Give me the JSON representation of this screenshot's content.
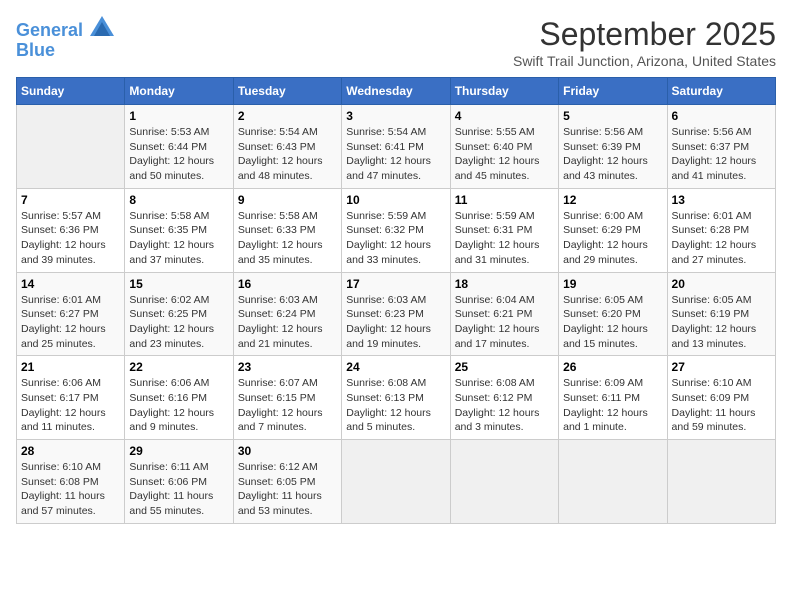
{
  "logo": {
    "line1": "General",
    "line2": "Blue"
  },
  "title": "September 2025",
  "location": "Swift Trail Junction, Arizona, United States",
  "days_of_week": [
    "Sunday",
    "Monday",
    "Tuesday",
    "Wednesday",
    "Thursday",
    "Friday",
    "Saturday"
  ],
  "weeks": [
    [
      {
        "day": "",
        "info": ""
      },
      {
        "day": "1",
        "info": "Sunrise: 5:53 AM\nSunset: 6:44 PM\nDaylight: 12 hours\nand 50 minutes."
      },
      {
        "day": "2",
        "info": "Sunrise: 5:54 AM\nSunset: 6:43 PM\nDaylight: 12 hours\nand 48 minutes."
      },
      {
        "day": "3",
        "info": "Sunrise: 5:54 AM\nSunset: 6:41 PM\nDaylight: 12 hours\nand 47 minutes."
      },
      {
        "day": "4",
        "info": "Sunrise: 5:55 AM\nSunset: 6:40 PM\nDaylight: 12 hours\nand 45 minutes."
      },
      {
        "day": "5",
        "info": "Sunrise: 5:56 AM\nSunset: 6:39 PM\nDaylight: 12 hours\nand 43 minutes."
      },
      {
        "day": "6",
        "info": "Sunrise: 5:56 AM\nSunset: 6:37 PM\nDaylight: 12 hours\nand 41 minutes."
      }
    ],
    [
      {
        "day": "7",
        "info": "Sunrise: 5:57 AM\nSunset: 6:36 PM\nDaylight: 12 hours\nand 39 minutes."
      },
      {
        "day": "8",
        "info": "Sunrise: 5:58 AM\nSunset: 6:35 PM\nDaylight: 12 hours\nand 37 minutes."
      },
      {
        "day": "9",
        "info": "Sunrise: 5:58 AM\nSunset: 6:33 PM\nDaylight: 12 hours\nand 35 minutes."
      },
      {
        "day": "10",
        "info": "Sunrise: 5:59 AM\nSunset: 6:32 PM\nDaylight: 12 hours\nand 33 minutes."
      },
      {
        "day": "11",
        "info": "Sunrise: 5:59 AM\nSunset: 6:31 PM\nDaylight: 12 hours\nand 31 minutes."
      },
      {
        "day": "12",
        "info": "Sunrise: 6:00 AM\nSunset: 6:29 PM\nDaylight: 12 hours\nand 29 minutes."
      },
      {
        "day": "13",
        "info": "Sunrise: 6:01 AM\nSunset: 6:28 PM\nDaylight: 12 hours\nand 27 minutes."
      }
    ],
    [
      {
        "day": "14",
        "info": "Sunrise: 6:01 AM\nSunset: 6:27 PM\nDaylight: 12 hours\nand 25 minutes."
      },
      {
        "day": "15",
        "info": "Sunrise: 6:02 AM\nSunset: 6:25 PM\nDaylight: 12 hours\nand 23 minutes."
      },
      {
        "day": "16",
        "info": "Sunrise: 6:03 AM\nSunset: 6:24 PM\nDaylight: 12 hours\nand 21 minutes."
      },
      {
        "day": "17",
        "info": "Sunrise: 6:03 AM\nSunset: 6:23 PM\nDaylight: 12 hours\nand 19 minutes."
      },
      {
        "day": "18",
        "info": "Sunrise: 6:04 AM\nSunset: 6:21 PM\nDaylight: 12 hours\nand 17 minutes."
      },
      {
        "day": "19",
        "info": "Sunrise: 6:05 AM\nSunset: 6:20 PM\nDaylight: 12 hours\nand 15 minutes."
      },
      {
        "day": "20",
        "info": "Sunrise: 6:05 AM\nSunset: 6:19 PM\nDaylight: 12 hours\nand 13 minutes."
      }
    ],
    [
      {
        "day": "21",
        "info": "Sunrise: 6:06 AM\nSunset: 6:17 PM\nDaylight: 12 hours\nand 11 minutes."
      },
      {
        "day": "22",
        "info": "Sunrise: 6:06 AM\nSunset: 6:16 PM\nDaylight: 12 hours\nand 9 minutes."
      },
      {
        "day": "23",
        "info": "Sunrise: 6:07 AM\nSunset: 6:15 PM\nDaylight: 12 hours\nand 7 minutes."
      },
      {
        "day": "24",
        "info": "Sunrise: 6:08 AM\nSunset: 6:13 PM\nDaylight: 12 hours\nand 5 minutes."
      },
      {
        "day": "25",
        "info": "Sunrise: 6:08 AM\nSunset: 6:12 PM\nDaylight: 12 hours\nand 3 minutes."
      },
      {
        "day": "26",
        "info": "Sunrise: 6:09 AM\nSunset: 6:11 PM\nDaylight: 12 hours\nand 1 minute."
      },
      {
        "day": "27",
        "info": "Sunrise: 6:10 AM\nSunset: 6:09 PM\nDaylight: 11 hours\nand 59 minutes."
      }
    ],
    [
      {
        "day": "28",
        "info": "Sunrise: 6:10 AM\nSunset: 6:08 PM\nDaylight: 11 hours\nand 57 minutes."
      },
      {
        "day": "29",
        "info": "Sunrise: 6:11 AM\nSunset: 6:06 PM\nDaylight: 11 hours\nand 55 minutes."
      },
      {
        "day": "30",
        "info": "Sunrise: 6:12 AM\nSunset: 6:05 PM\nDaylight: 11 hours\nand 53 minutes."
      },
      {
        "day": "",
        "info": ""
      },
      {
        "day": "",
        "info": ""
      },
      {
        "day": "",
        "info": ""
      },
      {
        "day": "",
        "info": ""
      }
    ]
  ]
}
